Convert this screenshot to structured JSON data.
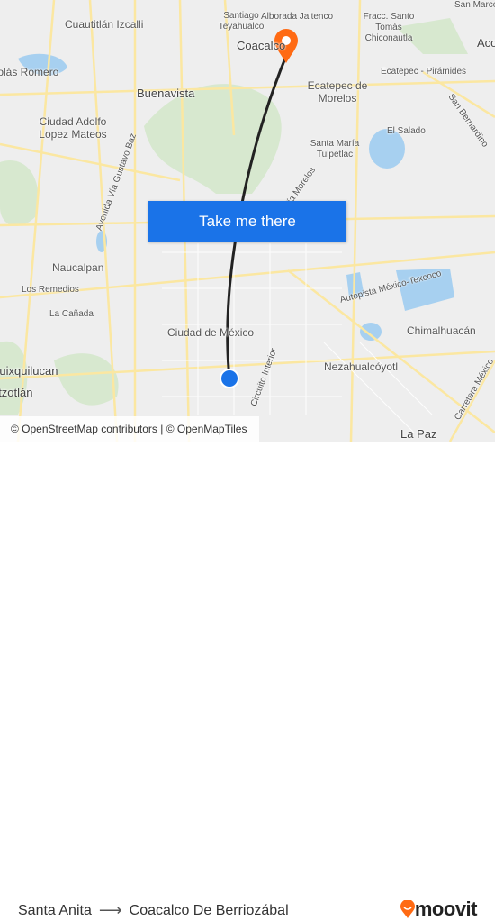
{
  "map": {
    "labels": [
      "Cuautitlán Izcalli",
      "Santiago Teyahualco",
      "Alborada Jaltenco",
      "Fracc. Santo Tomás Chiconautla",
      "San Marcos Nepantla",
      "Acolman",
      "Coacalco",
      "Buenavista",
      "Ecatepec de Morelos",
      "Ecatepec - Pirámides",
      "San Bernardino",
      "Nicolás Romero",
      "Ciudad Adolfo Lopez Mateos",
      "El Salado",
      "Santa María Tulpetlac",
      "Vía Morelos",
      "Avenida Vía Gustavo Baz",
      "Naucalpan",
      "Los Remedios",
      "La Cañada",
      "Autopista México-Texcoco",
      "Chimalhuacán",
      "Ciudad de México",
      "Circuito Interior",
      "Nezahualcóyotl",
      "Carretera México",
      "La Paz",
      "Huixquilucan",
      "Tepotzotlán"
    ],
    "route_color": "#222222",
    "destination_marker_color": "#ff6a13",
    "origin_marker_color": "#1a73e8"
  },
  "cta": {
    "label": "Take me there"
  },
  "attribution": "© OpenStreetMap contributors | © OpenMapTiles",
  "footer": {
    "origin": "Santa Anita",
    "destination": "Coacalco De Berriozábal",
    "arrow_icon": "arrow-right-icon",
    "logo_text": "moovit",
    "brand_color": "#ff6a13"
  }
}
